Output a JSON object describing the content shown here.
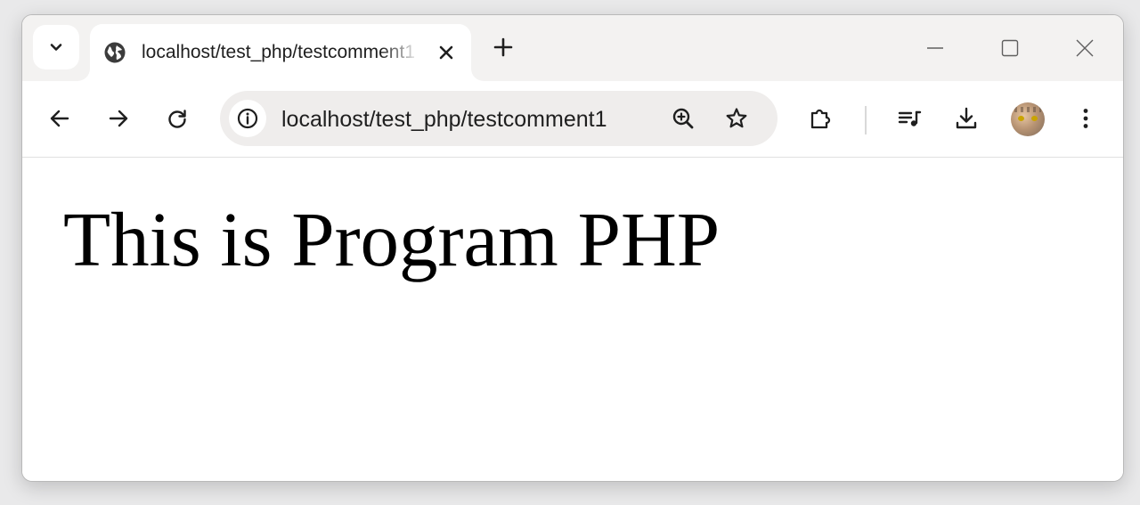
{
  "browser": {
    "tab": {
      "title": "localhost/test_php/testcomment1",
      "favicon": "globe-icon",
      "close_icon": "close-icon"
    },
    "tab_search_icon": "chevron-down-icon",
    "new_tab_icon": "plus-icon",
    "window_controls": [
      "minimize-icon",
      "maximize-icon",
      "close-icon"
    ],
    "toolbar": {
      "nav_icons": [
        "back-arrow-icon",
        "forward-arrow-icon",
        "reload-icon"
      ],
      "address": {
        "site_info_icon": "info-icon",
        "url": "localhost/test_php/testcomment1",
        "zoom_icon": "zoom-in-icon",
        "bookmark_icon": "star-icon"
      },
      "right_icons": [
        "extensions-icon",
        "media-control-icon",
        "download-icon",
        "profile-avatar",
        "more-vert-icon"
      ]
    }
  },
  "page": {
    "heading": "This is Program PHP"
  },
  "colors": {
    "tabstrip_bg": "#f3f2f1",
    "omnibox_bg": "#efedec",
    "icon": "#1f1f1f"
  }
}
